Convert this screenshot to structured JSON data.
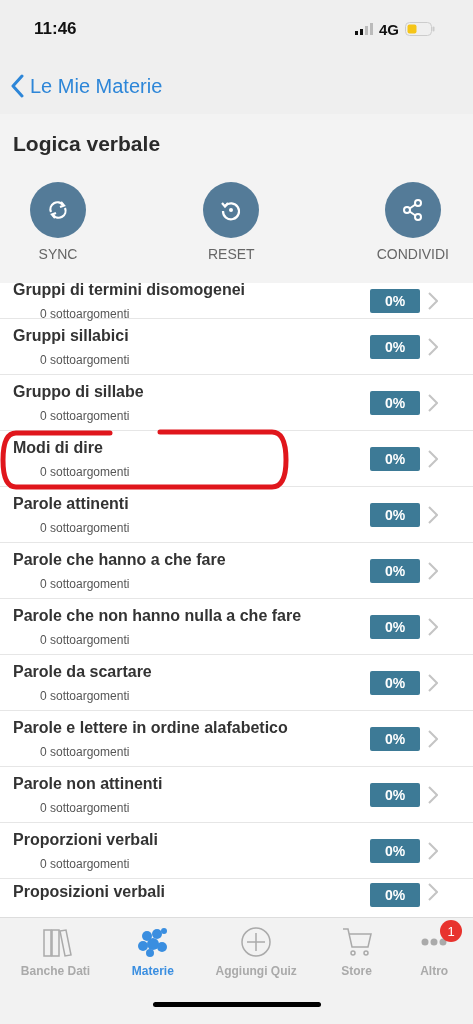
{
  "status_bar": {
    "time": "11:46",
    "network": "4G"
  },
  "nav": {
    "back_label": "Le Mie Materie"
  },
  "title": "Logica verbale",
  "actions": [
    {
      "kind": "sync",
      "label": "SYNC"
    },
    {
      "kind": "reset",
      "label": "RESET"
    },
    {
      "kind": "share",
      "label": "CONDIVIDI"
    }
  ],
  "topics": [
    {
      "name": "Gruppi di termini disomogenei",
      "subtitle": "0 sottoargomenti",
      "progress": "0%"
    },
    {
      "name": "Gruppi sillabici",
      "subtitle": "0 sottoargomenti",
      "progress": "0%"
    },
    {
      "name": "Gruppo di sillabe",
      "subtitle": "0 sottoargomenti",
      "progress": "0%"
    },
    {
      "name": "Modi di dire",
      "subtitle": "0 sottoargomenti",
      "progress": "0%"
    },
    {
      "name": "Parole attinenti",
      "subtitle": "0 sottoargomenti",
      "progress": "0%"
    },
    {
      "name": "Parole che hanno a che fare",
      "subtitle": "0 sottoargomenti",
      "progress": "0%"
    },
    {
      "name": "Parole che non hanno nulla a che fare",
      "subtitle": "0 sottoargomenti",
      "progress": "0%"
    },
    {
      "name": "Parole da scartare",
      "subtitle": "0 sottoargomenti",
      "progress": "0%"
    },
    {
      "name": "Parole e lettere in ordine alafabetico",
      "subtitle": "0 sottoargomenti",
      "progress": "0%"
    },
    {
      "name": "Parole non attinenti",
      "subtitle": "0 sottoargomenti",
      "progress": "0%"
    },
    {
      "name": "Proporzioni verbali",
      "subtitle": "0 sottoargomenti",
      "progress": "0%"
    },
    {
      "name": "Proposizioni verbali",
      "progress": "0%"
    }
  ],
  "tabs": [
    {
      "kind": "books",
      "label": "Banche Dati",
      "selected": false
    },
    {
      "kind": "cluster",
      "label": "Materie",
      "selected": true
    },
    {
      "kind": "add",
      "label": "Aggiungi Quiz",
      "selected": false
    },
    {
      "kind": "cart",
      "label": "Store",
      "selected": false
    },
    {
      "kind": "more",
      "label": "Altro",
      "selected": false,
      "badge": "1"
    }
  ]
}
